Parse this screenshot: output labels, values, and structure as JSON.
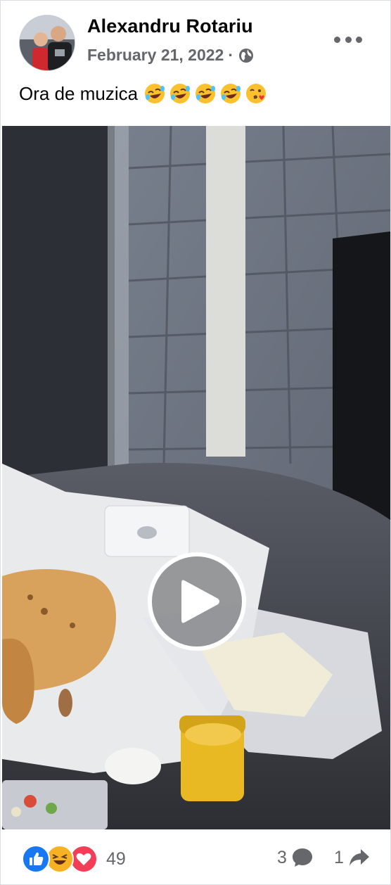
{
  "post": {
    "author": "Alexandru Rotariu",
    "date": "February 21, 2022",
    "separator": "·",
    "privacy_icon": "globe-icon",
    "caption_text": "Ora de muzica",
    "caption_emojis": [
      "rolling-on-floor-laughing",
      "rolling-on-floor-laughing",
      "rolling-on-floor-laughing",
      "rolling-on-floor-laughing",
      "face-blowing-kiss"
    ]
  },
  "video": {
    "play_icon": "play-icon"
  },
  "engagement": {
    "reaction_icons": [
      "like",
      "haha",
      "love"
    ],
    "reaction_count": "49",
    "comment_count": "3",
    "share_count": "1"
  },
  "colors": {
    "like_blue": "#1877f2",
    "love_red": "#f33e58",
    "haha_yellow": "#f7b125",
    "secondary_text": "#65676b"
  }
}
